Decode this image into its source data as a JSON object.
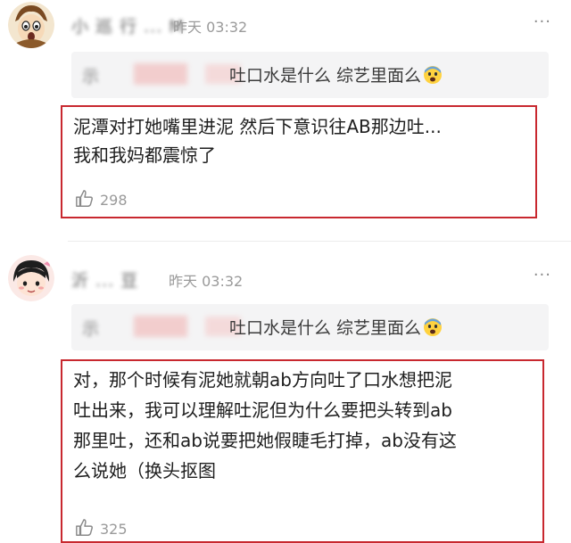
{
  "comments": [
    {
      "username": "小 巡 行 ... M",
      "time": "昨天 03:32",
      "more": "···",
      "quote": {
        "author": "示",
        "text": "吐口水是什么 综艺里面么"
      },
      "lines": [
        "泥潭对打她嘴里进泥 然后下意识往AB那边吐...",
        "我和我妈都震惊了"
      ],
      "likes": "298"
    },
    {
      "username": "沂 ... 豆",
      "time": "昨天 03:32",
      "more": "···",
      "quote": {
        "author": "示",
        "text": "吐口水是什么 综艺里面么"
      },
      "lines": [
        "对，那个时候有泥她就朝ab方向吐了口水想把泥",
        "吐出来，我可以理解吐泥但为什么要把头转到ab",
        "那里吐，还和ab说要把她假睫毛打掉，ab没有这",
        "么说她（换头抠图"
      ],
      "likes": "325"
    }
  ],
  "colors": {
    "highlight_box": "#c8282f",
    "meta_gray": "#9a9a9a",
    "quote_bg": "#f4f4f5"
  },
  "icons": {
    "like": "thumbs-up-icon",
    "emoji": "fearful-face-emoji",
    "more": "more-dots-icon"
  }
}
